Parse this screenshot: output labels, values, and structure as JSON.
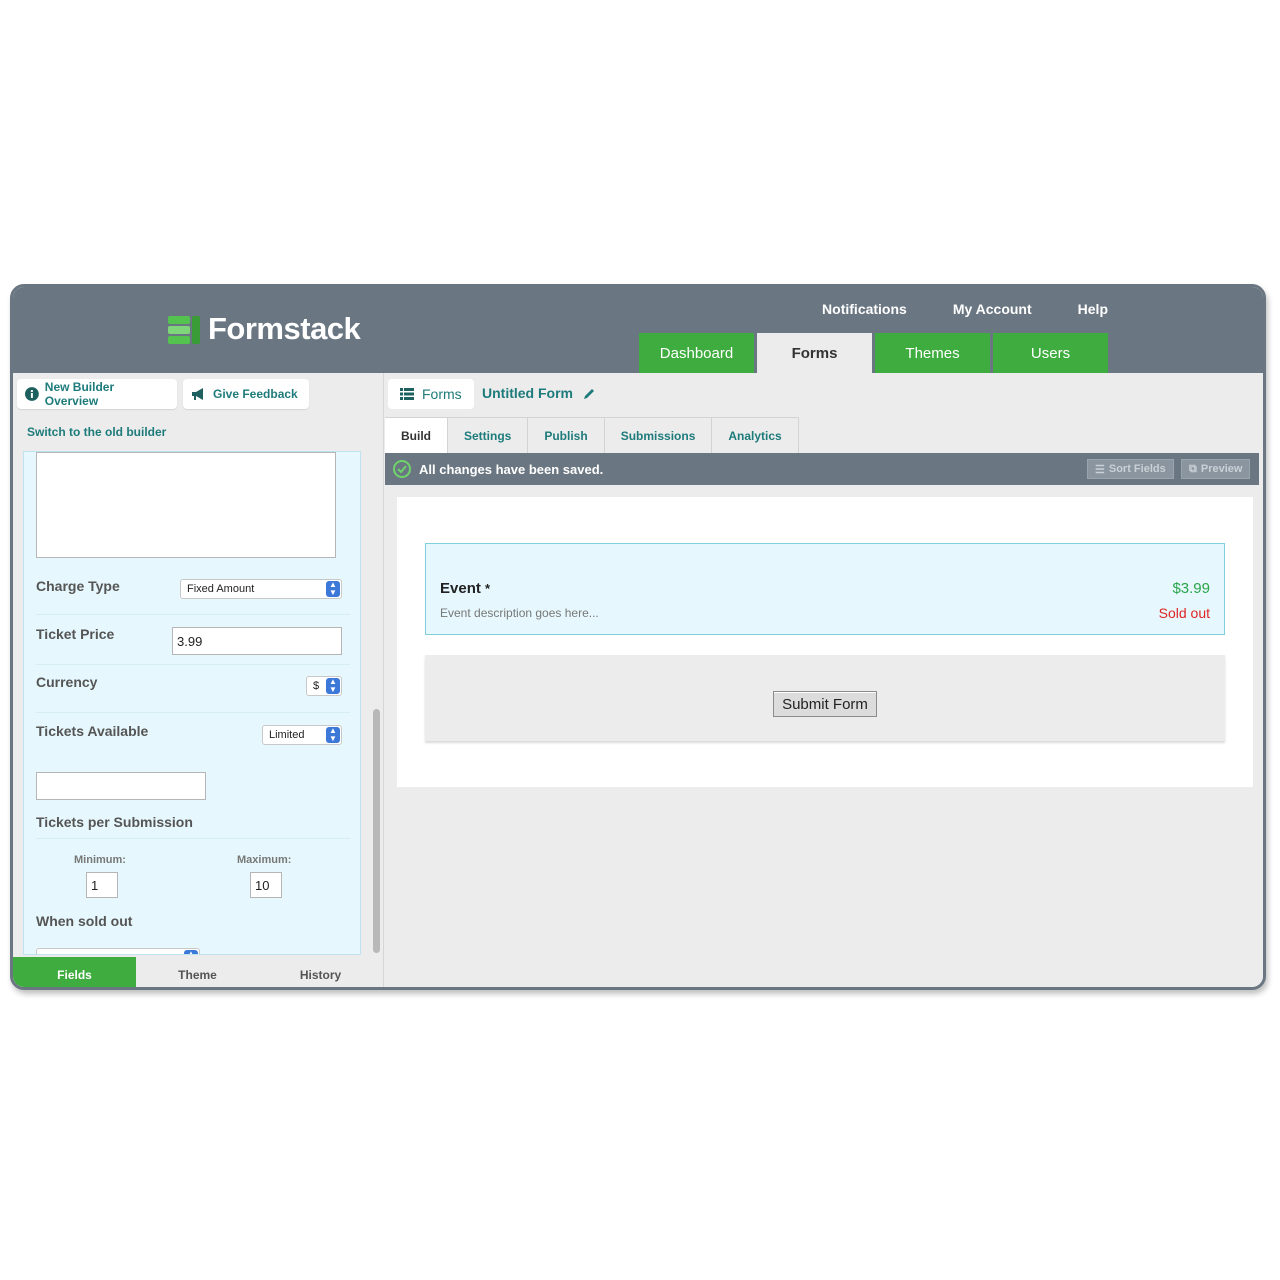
{
  "app": {
    "brand": "Formstack"
  },
  "topnav": {
    "notifications": "Notifications",
    "account": "My Account",
    "help": "Help"
  },
  "maintabs": [
    {
      "label": "Dashboard"
    },
    {
      "label": "Forms"
    },
    {
      "label": "Themes"
    },
    {
      "label": "Users"
    }
  ],
  "left": {
    "overview": "New Builder Overview",
    "feedback": "Give Feedback",
    "switch_link": "Switch to the old builder",
    "charge_type": {
      "label": "Charge Type",
      "value": "Fixed Amount"
    },
    "ticket_price": {
      "label": "Ticket Price",
      "value": "3.99"
    },
    "currency": {
      "label": "Currency",
      "value": "$"
    },
    "tickets_available": {
      "label": "Tickets Available",
      "value": "Limited",
      "amount": ""
    },
    "per_submission": {
      "label": "Tickets per Submission",
      "min_label": "Minimum:",
      "min_value": "1",
      "max_label": "Maximum:",
      "max_value": "10"
    },
    "sold_out": {
      "label": "When sold out"
    },
    "bottom_tabs": [
      {
        "label": "Fields"
      },
      {
        "label": "Theme"
      },
      {
        "label": "History"
      }
    ]
  },
  "right": {
    "breadcrumb": "Forms",
    "form_title": "Untitled Form",
    "subtabs": [
      {
        "label": "Build"
      },
      {
        "label": "Settings"
      },
      {
        "label": "Publish"
      },
      {
        "label": "Submissions"
      },
      {
        "label": "Analytics"
      }
    ],
    "status": "All changes have been saved.",
    "sort_fields": "Sort Fields",
    "preview": "Preview",
    "event": {
      "title": "Event",
      "required": "*",
      "description": "Event description goes here...",
      "price": "$3.99",
      "status": "Sold out"
    },
    "submit": "Submit Form"
  },
  "colors": {
    "header": "#6a7782",
    "green": "#3eac3e",
    "teal": "#1e7b7b",
    "panel": "#e6f8fd",
    "price": "#2aa54a",
    "soldout": "#e02424"
  }
}
